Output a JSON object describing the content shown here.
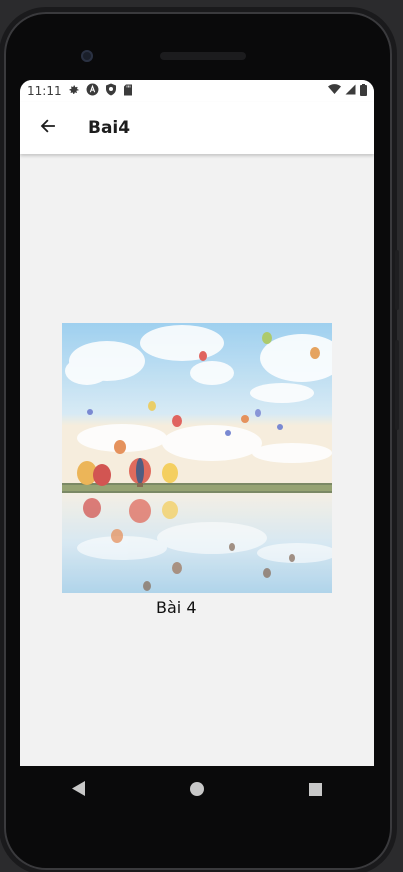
{
  "status_bar": {
    "time": "11:11",
    "icons_left": [
      "settings-icon",
      "accessibility-icon",
      "shield-icon",
      "sd-card-icon"
    ],
    "icons_right": [
      "wifi-icon",
      "signal-icon",
      "battery-icon"
    ]
  },
  "app_bar": {
    "back_icon": "arrow-back-icon",
    "title": "Bai4"
  },
  "content": {
    "image_subject": "hot-air-balloons-over-lake",
    "caption": "Bài 4"
  },
  "nav_bar": {
    "buttons": [
      "back-triangle",
      "home-circle",
      "recents-square"
    ]
  },
  "colors": {
    "screen_bg": "#f2f2f2",
    "bar_bg": "#ffffff",
    "text": "#111111"
  }
}
